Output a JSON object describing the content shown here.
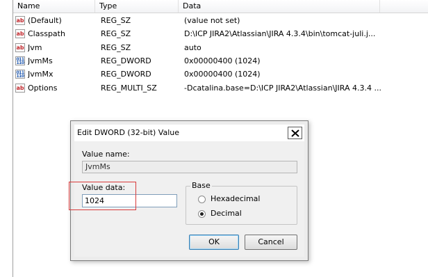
{
  "list": {
    "columns": [
      "Name",
      "Type",
      "Data"
    ],
    "rows": [
      {
        "name": "(Default)",
        "type": "REG_SZ",
        "data": "(value not set)",
        "icon": "string-value-icon"
      },
      {
        "name": "Classpath",
        "type": "REG_SZ",
        "data": "D:\\ICP JIRA2\\Atlassian\\JIRA 4.3.4\\bin\\tomcat-juli.j...",
        "icon": "string-value-icon"
      },
      {
        "name": "Jvm",
        "type": "REG_SZ",
        "data": "auto",
        "icon": "string-value-icon"
      },
      {
        "name": "JvmMs",
        "type": "REG_DWORD",
        "data": "0x00000400 (1024)",
        "icon": "dword-value-icon"
      },
      {
        "name": "JvmMx",
        "type": "REG_DWORD",
        "data": "0x00000400 (1024)",
        "icon": "dword-value-icon"
      },
      {
        "name": "Options",
        "type": "REG_MULTI_SZ",
        "data": "-Dcatalina.base=D:\\ICP JIRA2\\Atlassian\\JIRA 4.3.4 ...",
        "icon": "string-value-icon"
      }
    ],
    "icon_text": {
      "sz": "ab",
      "dword": "011\n110"
    }
  },
  "dialog": {
    "title": "Edit DWORD (32-bit) Value",
    "value_name_label": "Value name:",
    "value_name": "JvmMs",
    "value_data_label": "Value data:",
    "value_data": "1024",
    "base_label": "Base",
    "base_options": [
      {
        "label": "Hexadecimal",
        "checked": false
      },
      {
        "label": "Decimal",
        "checked": true
      }
    ],
    "ok_label": "OK",
    "cancel_label": "Cancel"
  },
  "colors": {
    "highlight": "#d83a3a",
    "string_icon": "#c3282d",
    "dword_icon": "#1e58b0"
  }
}
